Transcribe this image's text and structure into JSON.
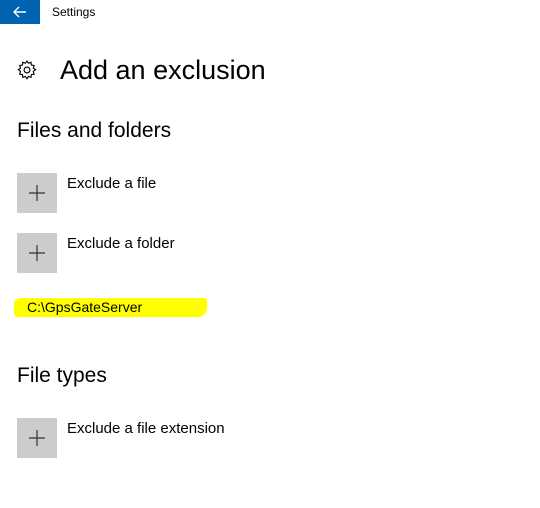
{
  "window": {
    "title": "Settings"
  },
  "header": {
    "title": "Add an exclusion"
  },
  "files_section": {
    "title": "Files and folders",
    "exclude_file_label": "Exclude a file",
    "exclude_folder_label": "Exclude a folder",
    "exclusions": [
      {
        "path": "C:\\GpsGateServer",
        "highlight_color": "#ffff00"
      }
    ]
  },
  "types_section": {
    "title": "File types",
    "exclude_extension_label": "Exclude a file extension"
  },
  "icons": {
    "back": "back-arrow-icon",
    "settings": "gear-icon",
    "add": "plus-icon"
  },
  "colors": {
    "accent": "#0063b1",
    "tile": "#cccccc",
    "highlight": "#ffff00"
  }
}
